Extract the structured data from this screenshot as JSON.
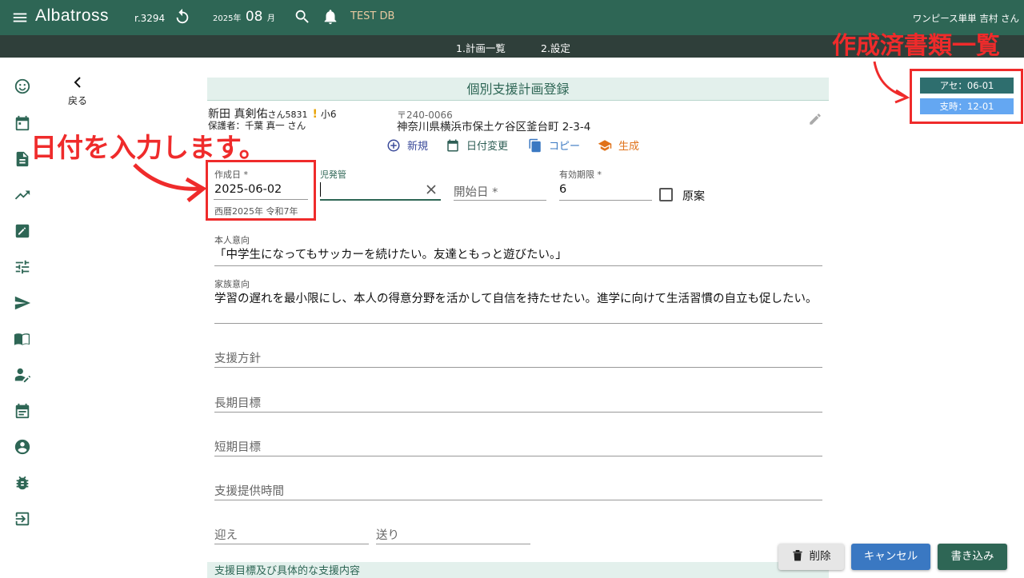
{
  "header": {
    "brand": "Albatross",
    "version": "r.3294",
    "year_label": "2025",
    "year_unit": "年",
    "month_label": "08",
    "month_unit": "月",
    "db_label": "TEST DB",
    "user_label": "ワンピース単単 吉村 さん"
  },
  "subnav": {
    "tab1": "1.計画一覧",
    "tab2": "2.設定"
  },
  "back_label": "戻る",
  "form": {
    "title": "個別支援計画登録",
    "child": {
      "name": "新田 真剣佑",
      "suffix": "さん5831",
      "alert": "!",
      "grade": "小6",
      "guardian": "保護者：千葉 真一 さん",
      "zip": "〒240-0066",
      "address": "神奈川県横浜市保土ケ谷区釜台町 2-3-4"
    },
    "actions": {
      "new": "新規",
      "date_change": "日付変更",
      "copy": "コピー",
      "generate": "生成"
    },
    "created_label": "作成日 *",
    "created_value": "2025-06-02",
    "created_hint": "西暦2025年 令和7年",
    "jisho_label": "児発管",
    "start_placeholder": "開始日 *",
    "expiry_label": "有効期限 *",
    "expiry_value": "6",
    "draft_label": "原案",
    "intent_self_label": "本人意向",
    "intent_self_value": "「中学生になってもサッカーを続けたい。友達ともっと遊びたい。」",
    "intent_family_label": "家族意向",
    "intent_family_value": "学習の遅れを最小限にし、本人の得意分野を活かして自信を持たせたい。進学に向けて生活習慣の自立も促したい。",
    "policy_placeholder": "支援方針",
    "long_goal_placeholder": "長期目標",
    "short_goal_placeholder": "短期目標",
    "hours_placeholder": "支援提供時間",
    "pickup_placeholder": "迎え",
    "dropoff_placeholder": "送り",
    "section_title": "支援目標及び具体的な支援内容"
  },
  "buttons": {
    "delete": "削除",
    "cancel": "キャンセル",
    "save": "書き込み"
  },
  "docs": {
    "doc1": "アセ：06-01",
    "doc2": "支時：12-01"
  },
  "annotations": {
    "docs_list": "作成済書類一覧",
    "enter_date": "日付を入力します。"
  },
  "colors": {
    "primary": "#2e6655",
    "accent_red": "#ef2b2b",
    "cancel_blue": "#3a78c2",
    "orange": "#e0721a"
  },
  "icons": [
    "menu-icon",
    "reload-icon",
    "search-icon",
    "bell-icon",
    "smile-icon",
    "calendar-icon",
    "document-icon",
    "trend-icon",
    "edit-icon",
    "tune-icon",
    "send-icon",
    "book-icon",
    "person-edit-icon",
    "event-icon",
    "account-icon",
    "bug-icon",
    "logout-icon",
    "chevron-left-icon",
    "pencil-icon",
    "add-circle-icon",
    "copy-icon",
    "graduation-cap-icon",
    "close-icon",
    "trash-icon"
  ]
}
